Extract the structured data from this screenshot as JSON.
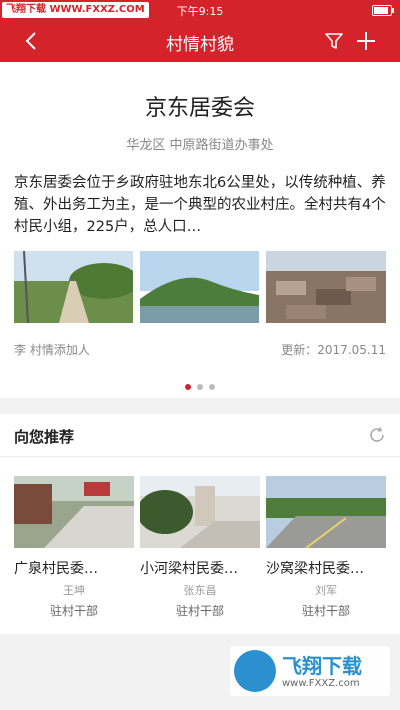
{
  "status_bar": {
    "watermark": "飞翔下载 WWW.FXXZ.COM",
    "time": "下午9:15",
    "battery_level": 0.85
  },
  "nav": {
    "title": "村情村貌",
    "back_icon": "chevron-left-icon",
    "filter_icon": "filter-icon",
    "add_icon": "plus-icon"
  },
  "village": {
    "name": "京东居委会",
    "district": "华龙区 中原路街道办事处",
    "intro": "京东居委会位于乡政府驻地东北6公里处，以传统种植、养殖、外出务工为主，是一个典型的农业村庄。全村共有4个村民小组，225户，总人口…",
    "photos": [
      "village-road-photo",
      "village-hill-pond-photo",
      "village-rooftops-photo"
    ],
    "added_by": "李 村情添加人",
    "updated": "更新：2017.05.11"
  },
  "carousel": {
    "count": 3,
    "active": 0
  },
  "accent_color": "#d4232b",
  "recommend": {
    "title": "向您推荐",
    "refresh_icon": "refresh-icon",
    "items": [
      {
        "name": "广泉村民委…",
        "person": "王坤",
        "role": "驻村干部"
      },
      {
        "name": "小河梁村民委…",
        "person": "张东昌",
        "role": "驻村干部"
      },
      {
        "name": "沙窝梁村民委…",
        "person": "刘军",
        "role": "驻村干部"
      }
    ]
  },
  "brand_watermark": {
    "name": "飞翔下载",
    "url": "www.FXXZ.com"
  }
}
